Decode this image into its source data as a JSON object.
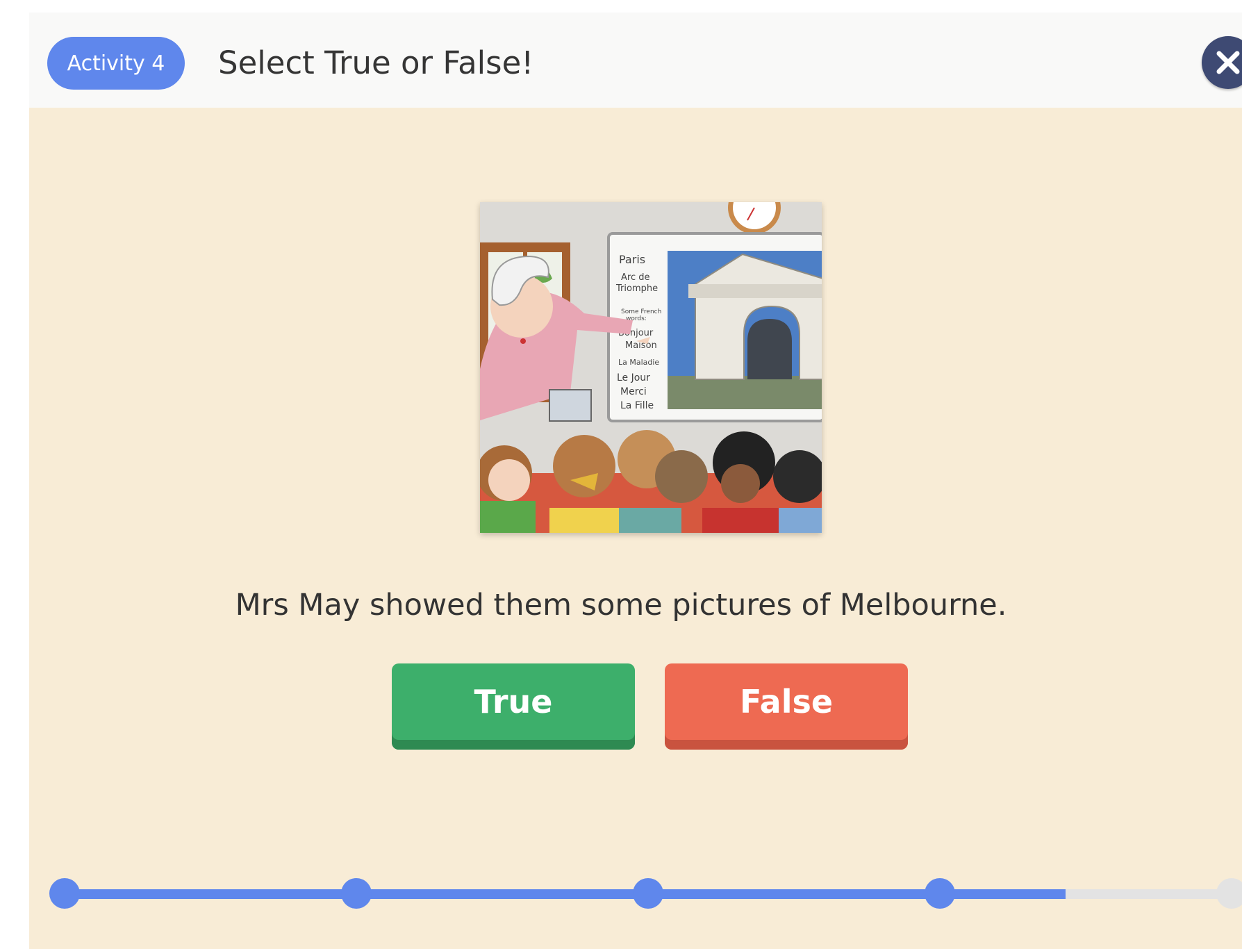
{
  "header": {
    "activity_badge": "Activity 4",
    "title": "Select True or False!"
  },
  "colors": {
    "accent_blue": "#5f87ec",
    "close_button": "#3e4a73",
    "background": "#f8ecd6",
    "true_button": "#3daf6b",
    "false_button": "#ee6a52"
  },
  "close_icon": "close-icon",
  "illustration": {
    "board_words": [
      "Paris",
      "Arc de",
      "Triomphe",
      "Some French",
      "words:",
      "Bonjour",
      "Maison",
      "La Maladie",
      "Le Jour",
      "Merci",
      "La Fille"
    ]
  },
  "question": {
    "statement": "Mrs May showed them some pictures of Melbourne."
  },
  "answers": {
    "true_label": "True",
    "false_label": "False"
  },
  "progress": {
    "total_steps": 5,
    "completed_steps": 4,
    "fill_fraction": 0.85
  }
}
